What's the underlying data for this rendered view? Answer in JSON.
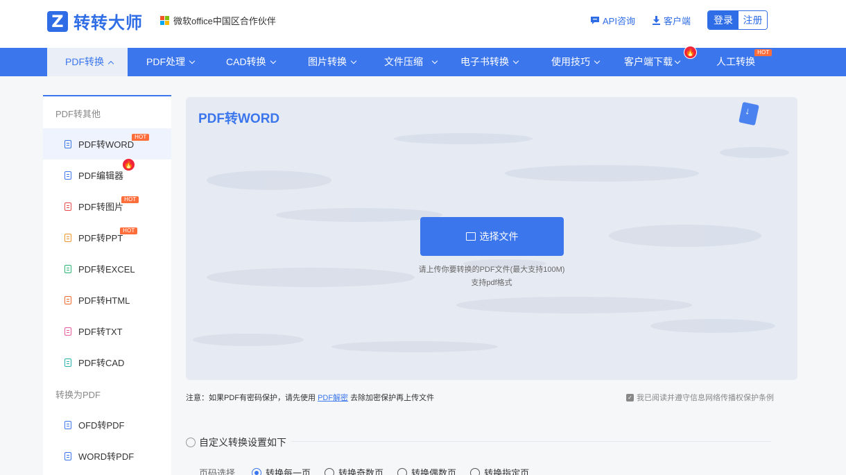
{
  "header": {
    "logo_text": "转转大师",
    "partner_text": "微软office中国区合作伙伴",
    "api_link": "API咨询",
    "client_link": "客户端",
    "login_label": "登录",
    "register_label": "注册"
  },
  "nav": {
    "items": [
      {
        "label": "PDF转换"
      },
      {
        "label": "PDF处理"
      },
      {
        "label": "CAD转换"
      },
      {
        "label": "图片转换"
      },
      {
        "label": "文件压缩"
      },
      {
        "label": "电子书转换"
      },
      {
        "label": "使用技巧"
      },
      {
        "label": "客户端下载"
      },
      {
        "label": "人工转换"
      }
    ],
    "hot_badge": "HOT"
  },
  "sidebar": {
    "group1": "PDF转其他",
    "group2": "转换为PDF",
    "items": [
      {
        "label": "PDF转WORD",
        "color": "#3b76ec"
      },
      {
        "label": "PDF编辑器",
        "color": "#3b76ec"
      },
      {
        "label": "PDF转图片",
        "color": "#e84a4a"
      },
      {
        "label": "PDF转PPT",
        "color": "#f0962e"
      },
      {
        "label": "PDF转EXCEL",
        "color": "#2bb673"
      },
      {
        "label": "PDF转HTML",
        "color": "#f06a2e"
      },
      {
        "label": "PDF转TXT",
        "color": "#e75aa0"
      },
      {
        "label": "PDF转CAD",
        "color": "#26b2a8"
      },
      {
        "label": "OFD转PDF",
        "color": "#3b76ec"
      },
      {
        "label": "WORD转PDF",
        "color": "#3b76ec"
      }
    ],
    "hot_badge": "HOT"
  },
  "upload": {
    "title": "PDF转WORD",
    "button_label": "选择文件",
    "hint_line1": "请上传你要转换的PDF文件(最大支持100M)",
    "hint_line2": "支持pdf格式"
  },
  "notice": {
    "prefix": "注意：如果PDF有密码保护，请先使用",
    "link": "PDF解密",
    "suffix": "去除加密保护再上传文件",
    "agree_text": "我已阅读并遵守信息网络传播权保护条例"
  },
  "settings": {
    "title": "自定义转换设置如下",
    "page_label": "页码选择",
    "options": [
      "转换每一页",
      "转换奇数页",
      "转换偶数页",
      "转换指定页"
    ],
    "selected": "转换每一页"
  },
  "colors": {
    "accent": "#3b76ec",
    "hot": "#ff6d3a",
    "fire": "#f0243a"
  }
}
